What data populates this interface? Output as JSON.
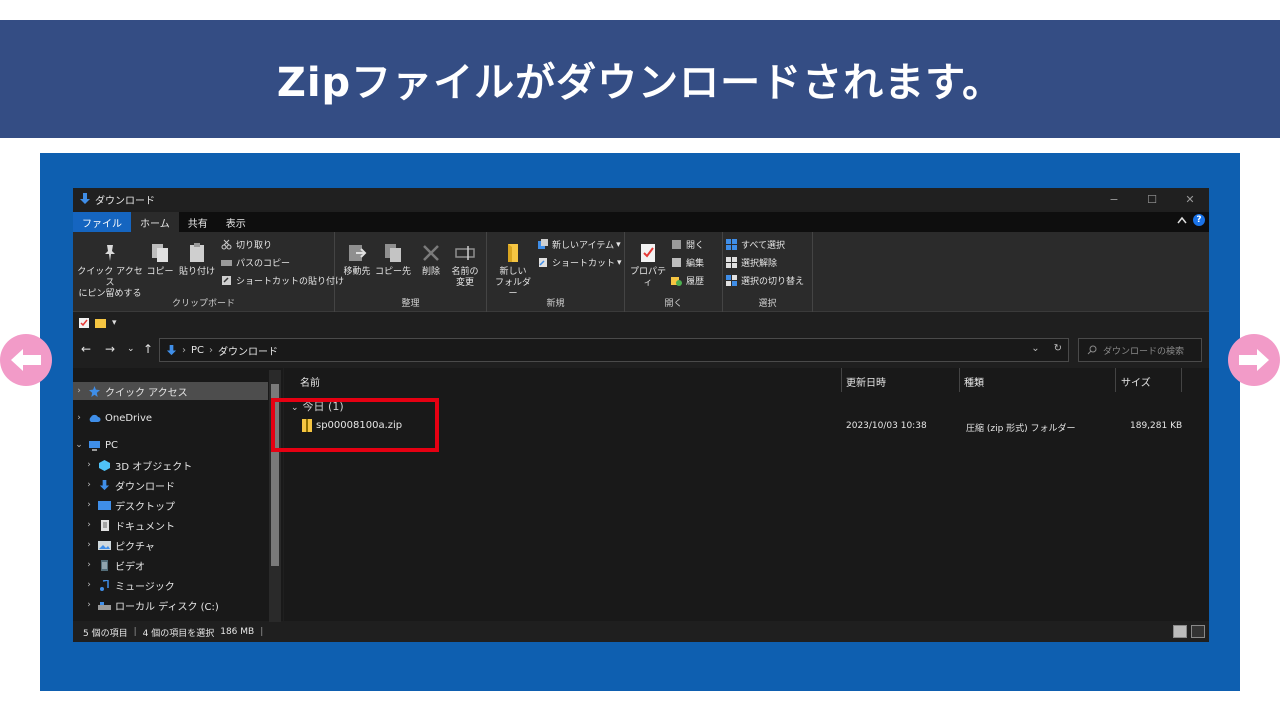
{
  "banner": {
    "title": "Zipファイルがダウンロードされます。"
  },
  "window": {
    "title": "ダウンロード",
    "controls": {
      "minimize": "−",
      "maximize": "☐",
      "close": "✕"
    },
    "tabs": [
      "ファイル",
      "ホーム",
      "共有",
      "表示"
    ],
    "ribbon": {
      "clipboard": {
        "label": "クリップボード",
        "pin_line1": "クイック アクセス",
        "pin_line2": "にピン留めする",
        "copy": "コピー",
        "paste": "貼り付け",
        "cut": "切り取り",
        "copy_path": "パスのコピー",
        "paste_shortcut": "ショートカットの貼り付け"
      },
      "organize": {
        "label": "整理",
        "move_to": "移動先",
        "copy_to": "コピー先",
        "delete": "削除",
        "rename_line1": "名前の",
        "rename_line2": "変更"
      },
      "new": {
        "label": "新規",
        "new_folder_line1": "新しい",
        "new_folder_line2": "フォルダー",
        "new_item": "新しいアイテム",
        "shortcut": "ショートカット"
      },
      "open": {
        "label": "開く",
        "properties": "プロパティ",
        "open": "開く",
        "edit": "編集",
        "history": "履歴"
      },
      "select": {
        "label": "選択",
        "select_all": "すべて選択",
        "select_none": "選択解除",
        "invert": "選択の切り替え"
      }
    },
    "address": {
      "crumbs": [
        "PC",
        "ダウンロード"
      ],
      "search_placeholder": "ダウンロードの検索"
    },
    "nav": [
      {
        "label": "クイック アクセス",
        "icon": "star-icon",
        "selected": true
      },
      {
        "label": "OneDrive",
        "icon": "cloud-icon"
      },
      {
        "label": "PC",
        "icon": "pc-icon"
      },
      {
        "label": "3D オブジェクト",
        "icon": "cube-icon"
      },
      {
        "label": "ダウンロード",
        "icon": "download-icon"
      },
      {
        "label": "デスクトップ",
        "icon": "desktop-icon"
      },
      {
        "label": "ドキュメント",
        "icon": "document-icon"
      },
      {
        "label": "ピクチャ",
        "icon": "pictures-icon"
      },
      {
        "label": "ビデオ",
        "icon": "video-icon"
      },
      {
        "label": "ミュージック",
        "icon": "music-icon"
      },
      {
        "label": "ローカル ディスク (C:)",
        "icon": "disk-icon"
      }
    ],
    "columns": [
      "名前",
      "更新日時",
      "種類",
      "サイズ"
    ],
    "group": "今日 (1)",
    "files": [
      {
        "name": "sp00008100a.zip",
        "modified": "2023/10/03 10:38",
        "type": "圧縮 (zip 形式) フォルダー",
        "size": "189,281 KB"
      }
    ],
    "status": {
      "count": "5 個の項目",
      "selected": "4 個の項目を選択",
      "size": "186 MB"
    }
  },
  "colors": {
    "banner": "#344d84",
    "frame": "#0e5fb0",
    "highlight": "#e60012",
    "arrow": "#f29bc8"
  }
}
